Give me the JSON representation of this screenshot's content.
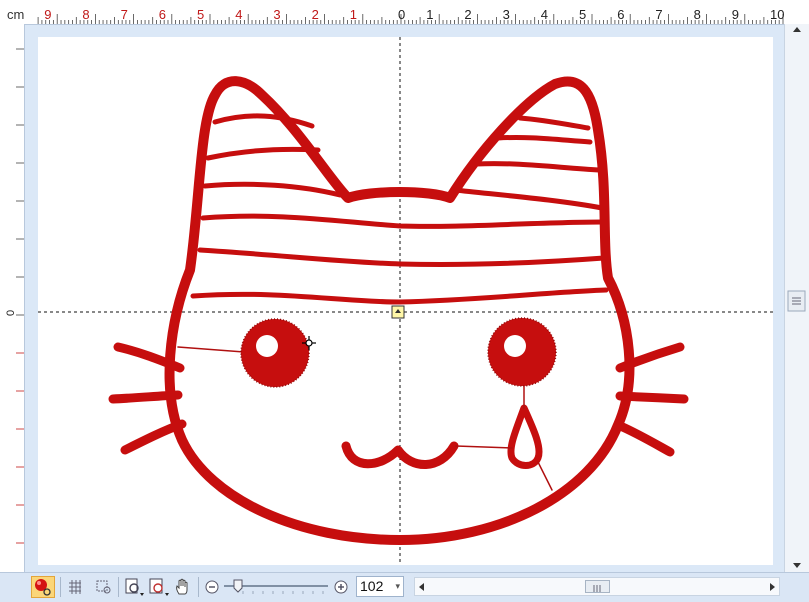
{
  "ruler": {
    "unit": "cm",
    "top_labels": [
      "9",
      "8",
      "7",
      "6",
      "5",
      "4",
      "3",
      "2",
      "1",
      "0",
      "1",
      "2",
      "3",
      "4",
      "5",
      "6",
      "7",
      "8",
      "9",
      "10"
    ],
    "left_label": "0"
  },
  "zoom": {
    "value": "102"
  },
  "colors": {
    "stitch": "#c60e0e",
    "stitch_dark": "#8f0505",
    "guide": "#111111"
  },
  "icons": {
    "stitch_player": "stitch-player-icon",
    "grid": "grid-icon",
    "zoom_box": "zoom-box-icon",
    "zoom_page": "zoom-page-icon",
    "zoom_selection": "zoom-selection-icon",
    "pan": "hand-icon",
    "zoom_out": "zoom-out-icon",
    "zoom_in": "zoom-in-icon"
  }
}
